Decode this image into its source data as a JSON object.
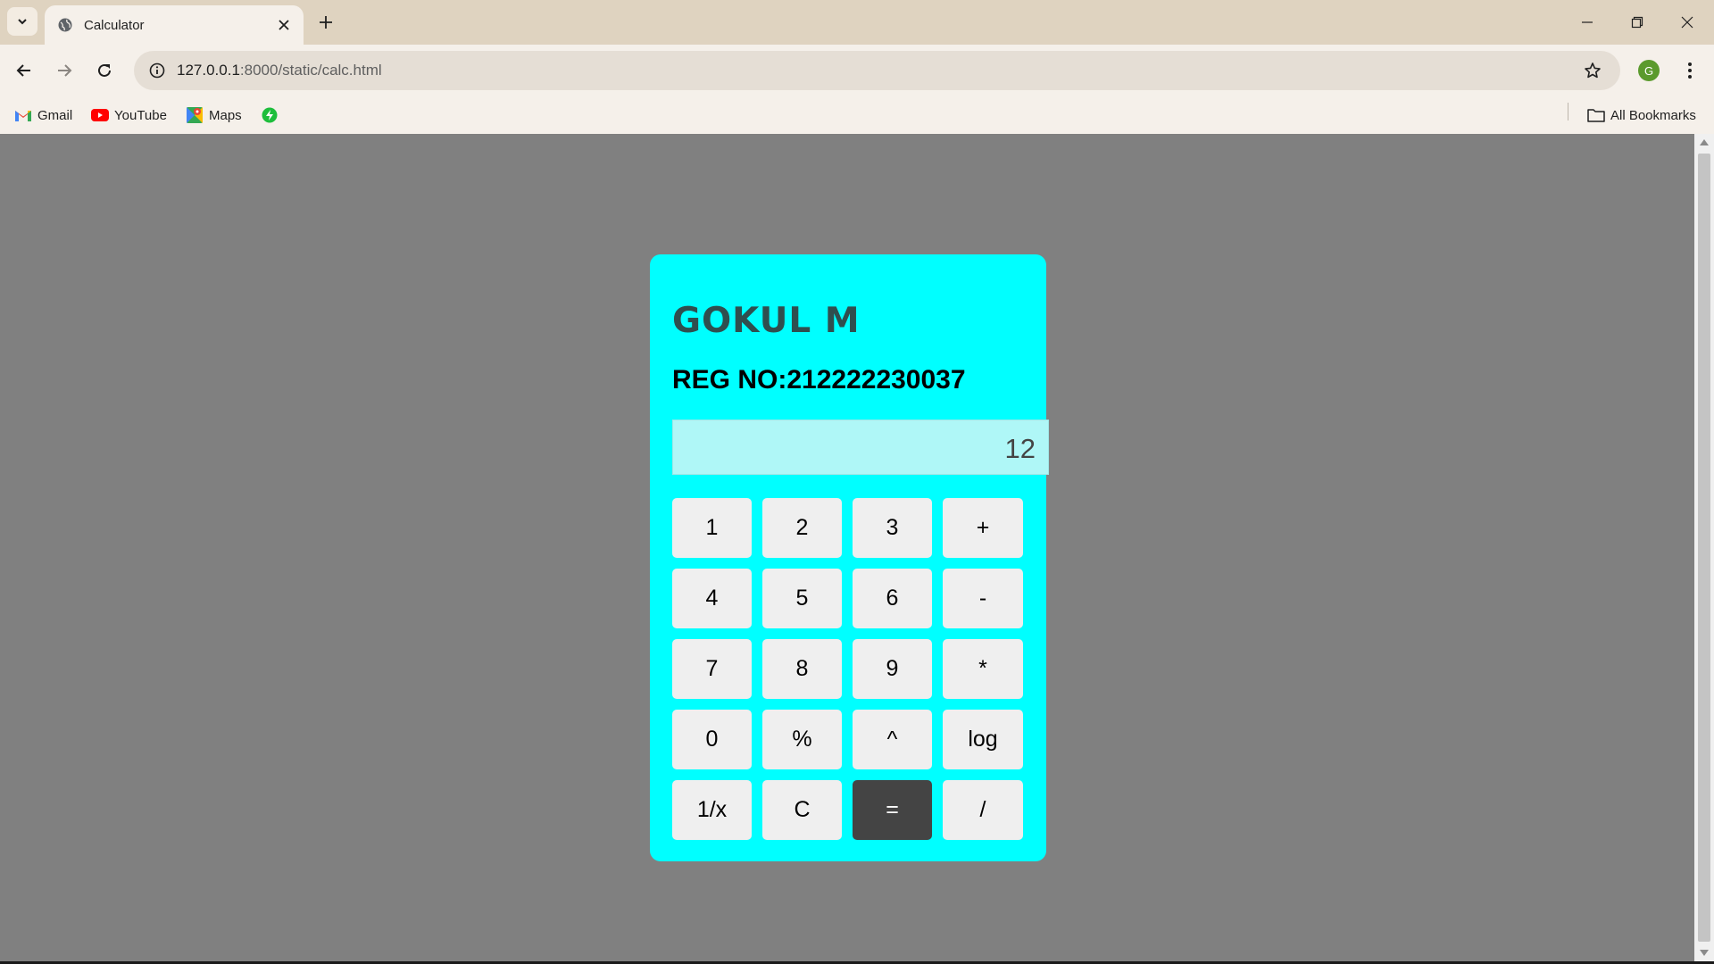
{
  "browser": {
    "tab": {
      "title": "Calculator"
    },
    "address_bar": {
      "host": "127.0.0.1",
      "path": ":8000/static/calc.html"
    },
    "profile_initial": "G",
    "bookmarks": [
      {
        "label": "Gmail",
        "icon": "gmail-icon"
      },
      {
        "label": "YouTube",
        "icon": "youtube-icon"
      },
      {
        "label": "Maps",
        "icon": "maps-icon"
      },
      {
        "label": "",
        "icon": "bolt-icon"
      }
    ],
    "all_bookmarks_label": "All Bookmarks"
  },
  "calculator": {
    "name": "GOKUL M",
    "reg": "REG NO:212222230037",
    "display_value": "12",
    "keys": [
      [
        "1",
        "2",
        "3",
        "+"
      ],
      [
        "4",
        "5",
        "6",
        "-"
      ],
      [
        "7",
        "8",
        "9",
        "*"
      ],
      [
        "0",
        "%",
        "^",
        "log"
      ],
      [
        "1/x",
        "C",
        "=",
        "/"
      ]
    ]
  },
  "colors": {
    "page_background": "#808080",
    "calculator_background": "#00ffff",
    "display_background": "#aff7f7",
    "key_background": "#efefef",
    "equals_key_background": "#444444"
  }
}
